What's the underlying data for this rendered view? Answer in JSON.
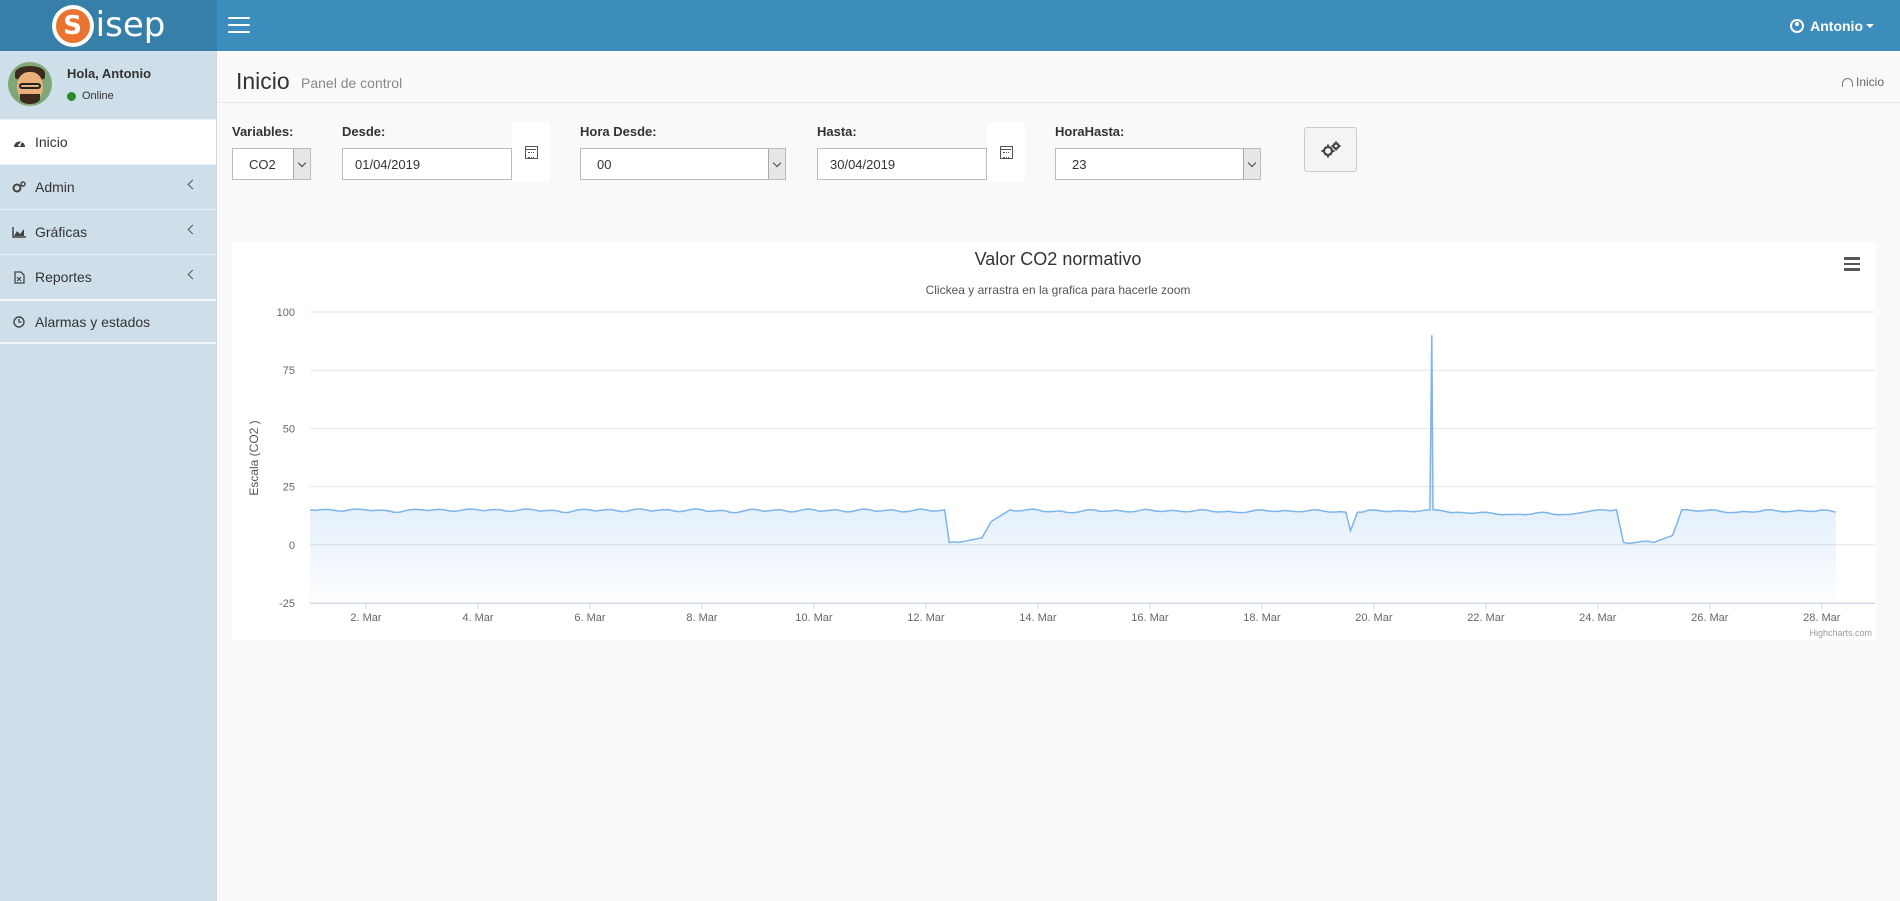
{
  "header": {
    "logo_letter": "S",
    "logo_text": "isep",
    "menu_icon": "hamburger-icon",
    "user_label": "Antonio"
  },
  "sidebar": {
    "greeting": "Hola, Antonio",
    "status": "Online",
    "status_color": "#2c8a2c",
    "items": [
      {
        "label": "Inicio",
        "icon": "dashboard-icon",
        "active": true
      },
      {
        "label": "Admin",
        "icon": "gears-icon"
      },
      {
        "label": "Gráficas",
        "icon": "area-chart-icon"
      },
      {
        "label": "Reportes",
        "icon": "file-excel-icon"
      },
      {
        "label": "Alarmas y estados",
        "icon": "clock-icon"
      }
    ]
  },
  "page": {
    "title": "Inicio",
    "subtitle": "Panel de control",
    "breadcrumb": "Inicio"
  },
  "filters": {
    "variables_label": "Variables:",
    "variables_value": "CO2",
    "desde_label": "Desde:",
    "desde_value": "01/04/2019",
    "hora_desde_label": "Hora Desde:",
    "hora_desde_value": "00",
    "hasta_label": "Hasta:",
    "hasta_value": "30/04/2019",
    "hora_hasta_label": "HoraHasta:",
    "hora_hasta_value": "23",
    "submit_icon": "gears-icon"
  },
  "colors": {
    "header": "#3c8dbc",
    "logo_bg": "#367fa9",
    "sidebar": "#cfdfe9",
    "series_line": "#7cb5ec"
  },
  "chart_data": {
    "type": "area",
    "title": "Valor CO2 normativo",
    "subtitle": "Clickea y arrastra en la grafica para hacerle zoom",
    "ylabel": "Escala (CO2 )",
    "xlabel": "",
    "ylim": [
      -25,
      100
    ],
    "yticks": [
      -25,
      0,
      25,
      50,
      75,
      100
    ],
    "xlim": [
      "2019-03-01",
      "2019-03-28"
    ],
    "xticks": [
      "2. Mar",
      "4. Mar",
      "6. Mar",
      "8. Mar",
      "10. Mar",
      "12. Mar",
      "14. Mar",
      "16. Mar",
      "18. Mar",
      "20. Mar",
      "22. Mar",
      "24. Mar",
      "26. Mar",
      "28. Mar"
    ],
    "xticks_iso": [
      "2019-03-02",
      "2019-03-04",
      "2019-03-06",
      "2019-03-08",
      "2019-03-10",
      "2019-03-12",
      "2019-03-14",
      "2019-03-16",
      "2019-03-18",
      "2019-03-20",
      "2019-03-22",
      "2019-03-24",
      "2019-03-26",
      "2019-03-28"
    ],
    "grid": true,
    "legend": "none",
    "credits": "Highcharts.com",
    "series": [
      {
        "x": [
          "2019-03-01",
          "2019-03-01 12:00",
          "2019-03-02",
          "2019-03-02 12:00",
          "2019-03-03",
          "2019-03-03 12:00",
          "2019-03-04",
          "2019-03-04 12:00",
          "2019-03-05",
          "2019-03-05 12:00",
          "2019-03-06",
          "2019-03-06 12:00",
          "2019-03-07",
          "2019-03-07 12:00",
          "2019-03-08",
          "2019-03-08 12:00",
          "2019-03-09",
          "2019-03-09 12:00",
          "2019-03-10",
          "2019-03-10 12:00",
          "2019-03-11",
          "2019-03-11 12:00",
          "2019-03-12",
          "2019-03-12 08:00",
          "2019-03-12 10:00",
          "2019-03-12 14:00",
          "2019-03-13",
          "2019-03-13 04:00",
          "2019-03-13 12:00",
          "2019-03-14",
          "2019-03-14 12:00",
          "2019-03-15",
          "2019-03-15 12:00",
          "2019-03-16",
          "2019-03-16 12:00",
          "2019-03-17",
          "2019-03-17 12:00",
          "2019-03-18",
          "2019-03-18 12:00",
          "2019-03-19",
          "2019-03-19 12:00",
          "2019-03-19 14:00",
          "2019-03-19 17:00",
          "2019-03-20",
          "2019-03-20 12:00",
          "2019-03-21",
          "2019-03-21 00:50",
          "2019-03-21 01:20",
          "2019-03-21 03:00",
          "2019-03-21 12:00",
          "2019-03-22",
          "2019-03-22 12:00",
          "2019-03-23",
          "2019-03-23 12:00",
          "2019-03-24",
          "2019-03-24 08:00",
          "2019-03-24 11:00",
          "2019-03-24 16:00",
          "2019-03-25",
          "2019-03-25 08:00",
          "2019-03-25 12:00",
          "2019-03-26",
          "2019-03-26 12:00",
          "2019-03-27",
          "2019-03-27 12:00",
          "2019-03-28",
          "2019-03-28 06:00"
        ],
        "values": [
          15,
          14.5,
          15,
          14,
          15,
          14.5,
          15,
          14.5,
          15,
          14,
          15,
          14.5,
          15,
          14.5,
          15,
          14,
          15,
          14.5,
          15,
          14.5,
          15,
          14.5,
          15,
          15,
          1,
          1,
          3,
          10,
          15,
          15,
          14,
          15,
          14.5,
          15,
          14.5,
          15,
          14,
          15,
          14.5,
          15,
          14,
          6,
          14,
          15,
          14.5,
          15,
          90,
          15,
          15,
          14,
          14,
          13,
          14,
          13,
          15,
          15,
          1,
          1,
          1,
          4,
          15,
          15,
          14,
          15,
          14.5,
          15,
          14
        ]
      }
    ]
  }
}
